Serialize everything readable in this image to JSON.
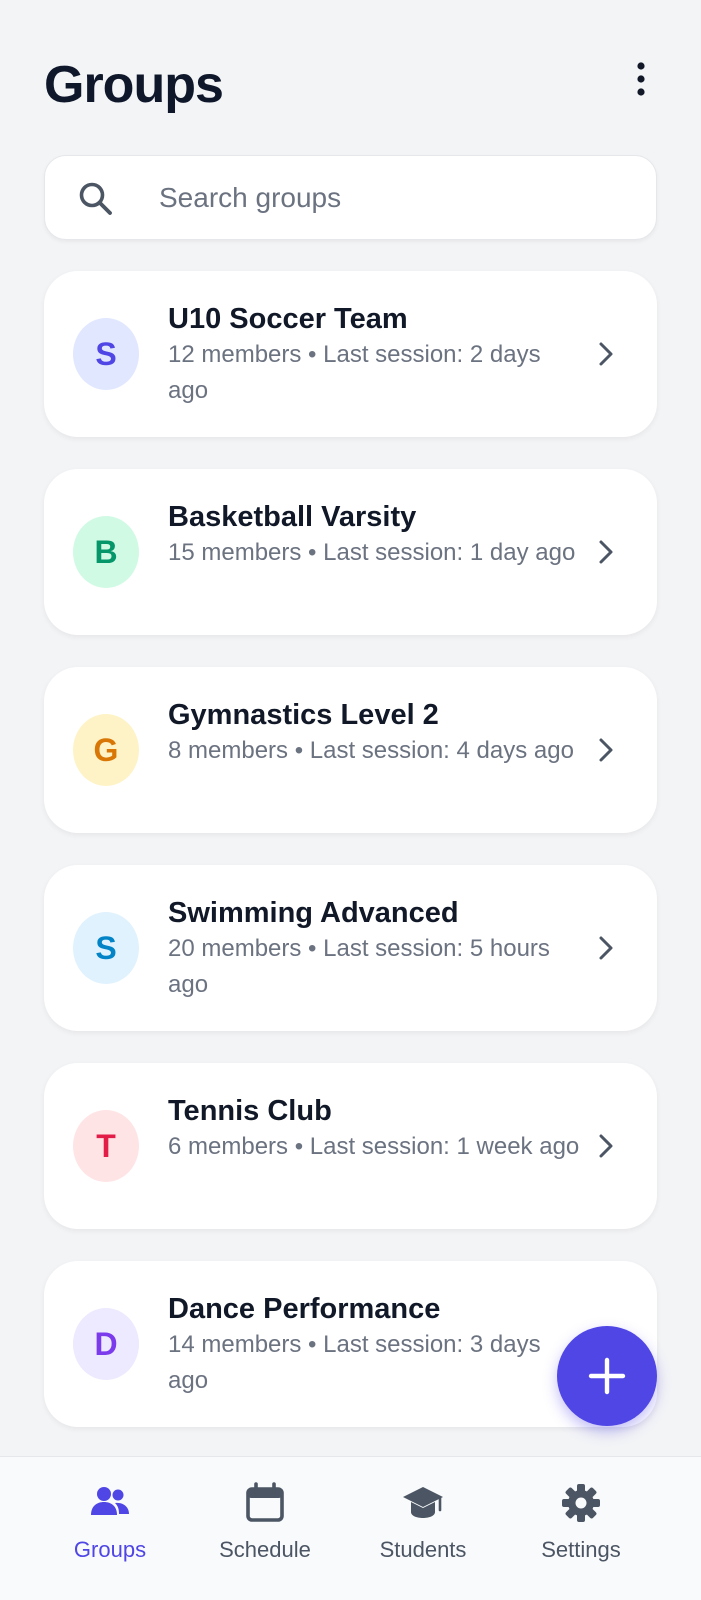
{
  "header": {
    "title": "Groups",
    "menu_icon": "more-vertical-icon"
  },
  "search": {
    "placeholder": "Search groups",
    "value": ""
  },
  "groups": [
    {
      "initial": "S",
      "name": "U10 Soccer Team",
      "meta": "12 members • Last session: 2 days ago",
      "avatar_bg": "#e0e7ff",
      "avatar_fg": "#4f46e5"
    },
    {
      "initial": "B",
      "name": "Basketball Varsity",
      "meta": "15 members • Last session: 1 day ago",
      "avatar_bg": "#d1fae5",
      "avatar_fg": "#059669"
    },
    {
      "initial": "G",
      "name": "Gymnastics Level 2",
      "meta": "8 members • Last session: 4 days ago",
      "avatar_bg": "#fef3c7",
      "avatar_fg": "#d97706"
    },
    {
      "initial": "S",
      "name": "Swimming Advanced",
      "meta": "20 members • Last session: 5 hours ago",
      "avatar_bg": "#e0f2fe",
      "avatar_fg": "#0284c7"
    },
    {
      "initial": "T",
      "name": "Tennis Club",
      "meta": "6 members • Last session: 1 week ago",
      "avatar_bg": "#ffe4e6",
      "avatar_fg": "#e11d48"
    },
    {
      "initial": "D",
      "name": "Dance Performance",
      "meta": "14 members • Last session: 3 days ago",
      "avatar_bg": "#ede9fe",
      "avatar_fg": "#7c3aed"
    }
  ],
  "fab": {
    "icon": "plus-icon"
  },
  "nav": {
    "items": [
      {
        "label": "Groups",
        "icon": "users-icon",
        "active": true
      },
      {
        "label": "Schedule",
        "icon": "calendar-icon",
        "active": false
      },
      {
        "label": "Students",
        "icon": "graduation-cap-icon",
        "active": false
      },
      {
        "label": "Settings",
        "icon": "gear-icon",
        "active": false
      }
    ]
  },
  "colors": {
    "accent": "#4f46e5",
    "background": "#f3f4f6",
    "card": "#ffffff",
    "muted_text": "#6b7280"
  }
}
